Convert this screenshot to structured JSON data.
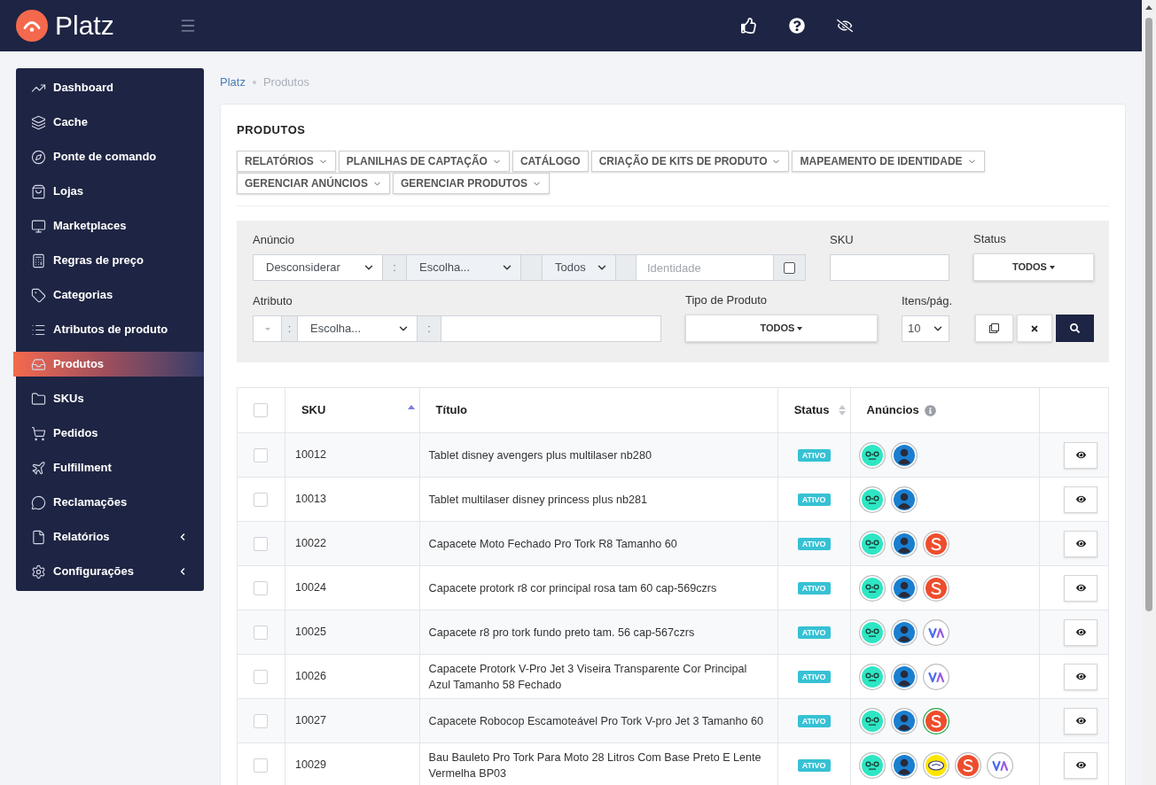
{
  "topbar": {
    "brand": "Platz"
  },
  "sidebar": {
    "items": [
      {
        "label": "Dashboard",
        "kind": "link",
        "selected": false
      },
      {
        "label": "Cache",
        "kind": "link",
        "selected": false
      },
      {
        "label": "Ponte de comando",
        "kind": "link",
        "selected": false
      },
      {
        "label": "Lojas",
        "kind": "link",
        "selected": false
      },
      {
        "label": "Marketplaces",
        "kind": "link",
        "selected": false
      },
      {
        "label": "Regras de preço",
        "kind": "link",
        "selected": false
      },
      {
        "label": "Categorias",
        "kind": "link",
        "selected": false
      },
      {
        "label": "Atributos de produto",
        "kind": "link",
        "selected": false
      },
      {
        "label": "Produtos",
        "kind": "link",
        "selected": true
      },
      {
        "label": "SKUs",
        "kind": "link",
        "selected": false
      },
      {
        "label": "Pedidos",
        "kind": "link",
        "selected": false
      },
      {
        "label": "Fulfillment",
        "kind": "link",
        "selected": false
      },
      {
        "label": "Reclamações",
        "kind": "link",
        "selected": false
      },
      {
        "label": "Relatórios",
        "kind": "group",
        "selected": false,
        "expanded": false
      },
      {
        "label": "Configurações",
        "kind": "group",
        "selected": false,
        "expanded": false
      }
    ]
  },
  "breadcrumb": [
    {
      "label": "Platz",
      "kind": "link"
    },
    {
      "label": "Produtos",
      "kind": "current"
    }
  ],
  "page": {
    "title": "PRODUTOS",
    "toolbar": [
      {
        "label": "RELATÓRIOS",
        "dropdown": true
      },
      {
        "label": "PLANILHAS DE CAPTAÇÃO",
        "dropdown": true
      },
      {
        "label": "CATÁLOGO",
        "dropdown": false
      },
      {
        "label": "CRIAÇÃO DE KITS DE PRODUTO",
        "dropdown": true
      },
      {
        "label": "MAPEAMENTO DE IDENTIDADE",
        "dropdown": true
      },
      {
        "label": "GERENCIAR ANÚNCIOS",
        "dropdown": true
      },
      {
        "label": "GERENCIAR PRODUTOS",
        "dropdown": true
      }
    ]
  },
  "filters": {
    "anuncio": {
      "label": "Anúncio",
      "mode": {
        "value": "Desconsiderar",
        "disabled": false
      },
      "separator": ":",
      "marketplace": {
        "value": "Escolha...",
        "disabled": true
      },
      "scope": {
        "value": "Todos",
        "disabled": true
      },
      "identity": {
        "placeholder": "Identidade"
      },
      "identity_check": {
        "checked": false
      }
    },
    "sku": {
      "label": "SKU"
    },
    "status": {
      "label": "Status",
      "value": "TODOS"
    },
    "atributo": {
      "label": "Atributo",
      "type": {
        "disabled": true
      },
      "separator_1": ":",
      "attribute": {
        "value": "Escolha...",
        "disabled": false
      },
      "separator_2": ":"
    },
    "tipo_produto": {
      "label": "Tipo de Produto",
      "value": "TODOS"
    },
    "itens_pagina": {
      "label": "Itens/pág.",
      "value": "10"
    }
  },
  "table": {
    "columns": [
      {
        "kind": "checkbox",
        "checked": false
      },
      {
        "kind": "text",
        "label": "SKU",
        "sortable": true,
        "sorted": true,
        "info": false
      },
      {
        "kind": "text",
        "label": "Título",
        "sortable": false,
        "info": false
      },
      {
        "kind": "text",
        "label": "Status",
        "sortable": true,
        "sorted": false,
        "info": false
      },
      {
        "kind": "text",
        "label": "Anúncios",
        "sortable": false,
        "info": true
      },
      {
        "kind": "actions"
      }
    ],
    "rows": [
      {
        "checked": false,
        "sku": "10012",
        "title": "Tablet disney avengers plus multilaser nb280",
        "status": "ATIVO",
        "anuncios": [
          {
            "kind": "dots",
            "highlighted": false
          },
          {
            "kind": "avatar",
            "highlighted": false
          }
        ]
      },
      {
        "checked": false,
        "sku": "10013",
        "title": "Tablet multilaser disney princess plus nb281",
        "status": "ATIVO",
        "anuncios": [
          {
            "kind": "dots",
            "highlighted": false
          },
          {
            "kind": "avatar",
            "highlighted": false
          }
        ]
      },
      {
        "checked": false,
        "sku": "10022",
        "title": "Capacete Moto Fechado Pro Tork R8 Tamanho 60",
        "status": "ATIVO",
        "anuncios": [
          {
            "kind": "dots",
            "highlighted": false
          },
          {
            "kind": "avatar",
            "highlighted": false
          },
          {
            "kind": "s",
            "highlighted": false
          }
        ]
      },
      {
        "checked": false,
        "sku": "10024",
        "title": "Capacete protork r8 cor principal rosa tam 60 cap-569czrs",
        "status": "ATIVO",
        "anuncios": [
          {
            "kind": "dots",
            "highlighted": false
          },
          {
            "kind": "avatar",
            "highlighted": false
          },
          {
            "kind": "s",
            "highlighted": false
          }
        ]
      },
      {
        "checked": false,
        "sku": "10025",
        "title": "Capacete r8 pro tork fundo preto tam. 56 cap-567czrs",
        "status": "ATIVO",
        "anuncios": [
          {
            "kind": "dots",
            "highlighted": false
          },
          {
            "kind": "avatar",
            "highlighted": false
          },
          {
            "kind": "zigzag",
            "highlighted": false
          }
        ]
      },
      {
        "checked": false,
        "sku": "10026",
        "title": "Capacete Protork V-Pro Jet 3 Viseira Transparente Cor Principal Azul Tamanho 58 Fechado",
        "status": "ATIVO",
        "anuncios": [
          {
            "kind": "dots",
            "highlighted": false
          },
          {
            "kind": "avatar",
            "highlighted": false
          },
          {
            "kind": "zigzag",
            "highlighted": false
          }
        ]
      },
      {
        "checked": false,
        "sku": "10027",
        "title": "Capacete Robocop Escamoteável Pro Tork V-pro Jet 3 Tamanho 60",
        "status": "ATIVO",
        "anuncios": [
          {
            "kind": "dots",
            "highlighted": false
          },
          {
            "kind": "avatar",
            "highlighted": false
          },
          {
            "kind": "s",
            "highlighted": true
          }
        ]
      },
      {
        "checked": false,
        "sku": "10029",
        "title": "Bau Bauleto Pro Tork Para Moto 28 Litros Com Base Preto E Lente Vermelha BP03",
        "status": "ATIVO",
        "anuncios": [
          {
            "kind": "dots",
            "highlighted": false
          },
          {
            "kind": "avatar",
            "highlighted": false
          },
          {
            "kind": "oval",
            "highlighted": false
          },
          {
            "kind": "s",
            "highlighted": false
          },
          {
            "kind": "zigzag",
            "highlighted": false
          }
        ]
      }
    ]
  }
}
